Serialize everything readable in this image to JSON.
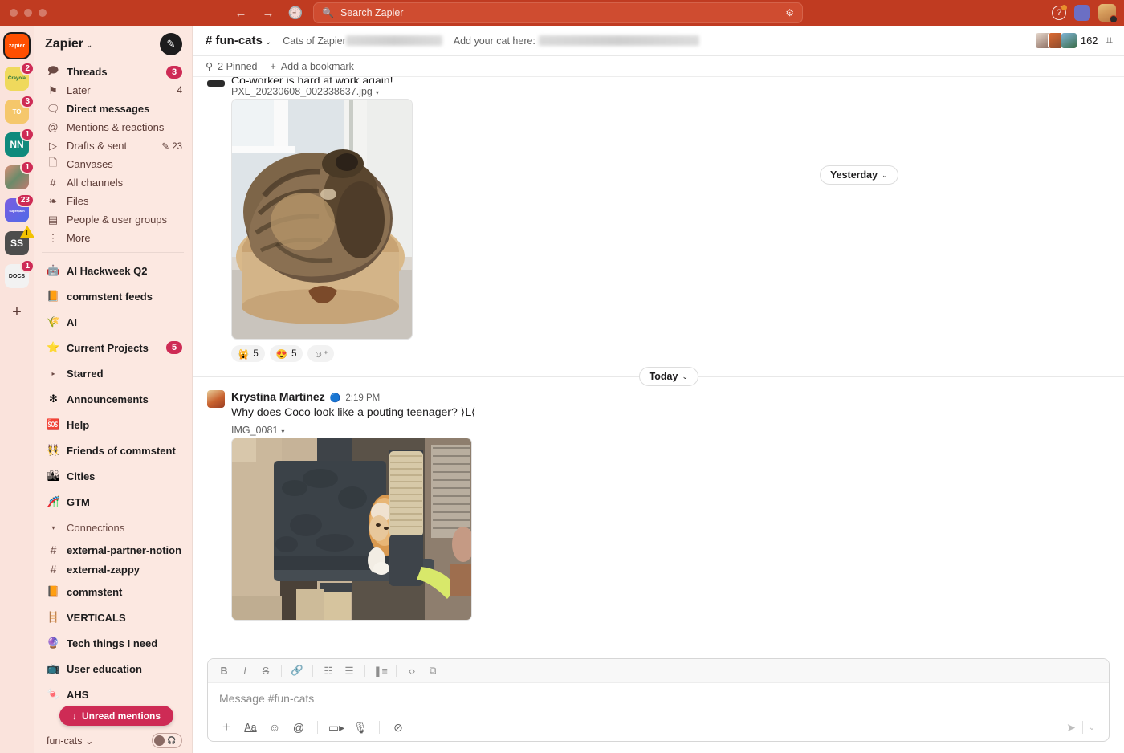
{
  "titlebar": {
    "back_icon": "back-arrow-icon",
    "forward_icon": "forward-arrow-icon",
    "history_icon": "history-clock-icon",
    "search_placeholder": "Search Zapier",
    "search_icon": "search-icon",
    "filter_icon": "search-filter-icon",
    "help_label": "?",
    "accent": "#C03B21"
  },
  "rail": {
    "workspaces": [
      {
        "name": "zapier",
        "label": "zapier",
        "badge": "",
        "active": true,
        "color": "#FF4F00"
      },
      {
        "name": "crayola",
        "label": "Crayola",
        "badge": "2",
        "active": false,
        "color": "#F3D84C"
      },
      {
        "name": "to",
        "label": "TO",
        "badge": "3",
        "active": false,
        "color": "#F5C26B"
      },
      {
        "name": "nn",
        "label": "NN",
        "badge": "1",
        "active": false,
        "color": "#0E8A7B"
      },
      {
        "name": "faces",
        "label": "",
        "badge": "1",
        "active": false,
        "color": "#C98B7A"
      },
      {
        "name": "superpath",
        "label": "superpath",
        "badge": "23",
        "active": false,
        "color": "#6C5CE7"
      },
      {
        "name": "ss",
        "label": "SS",
        "badge": "",
        "warning": true,
        "active": false,
        "color": "#4A4A4A"
      },
      {
        "name": "docs",
        "label": "DOCS",
        "badge": "1",
        "active": false,
        "color": "#E8E8E8"
      }
    ],
    "add_label": "+"
  },
  "sidebar": {
    "workspace_name": "Zapier",
    "chevron": "⌄",
    "compose_icon": "compose-pencil-icon",
    "nav": [
      {
        "icon": "💬",
        "icon_name": "threads-icon",
        "label": "Threads",
        "badge": "3",
        "count": "",
        "bold": true
      },
      {
        "icon": "🔖",
        "icon_name": "later-bookmark-icon",
        "label": "Later",
        "badge": "",
        "count": "4",
        "bold": false
      },
      {
        "icon": "🗨",
        "icon_name": "direct-messages-icon",
        "label": "Direct messages",
        "badge": "",
        "count": "",
        "bold": true
      },
      {
        "icon": "@",
        "icon_name": "mentions-at-icon",
        "label": "Mentions & reactions",
        "badge": "",
        "count": "",
        "bold": false
      },
      {
        "icon": "➤",
        "icon_name": "drafts-send-icon",
        "label": "Drafts & sent",
        "badge": "",
        "count": "✎ 23",
        "bold": false
      },
      {
        "icon": "🗒",
        "icon_name": "canvases-icon",
        "label": "Canvases",
        "badge": "",
        "count": "",
        "bold": false
      },
      {
        "icon": "#",
        "icon_name": "all-channels-icon",
        "label": "All channels",
        "badge": "",
        "count": "",
        "bold": false
      },
      {
        "icon": "≋",
        "icon_name": "files-stack-icon",
        "label": "Files",
        "badge": "",
        "count": "",
        "bold": false
      },
      {
        "icon": "▤",
        "icon_name": "people-groups-icon",
        "label": "People & user groups",
        "badge": "",
        "count": "",
        "bold": false
      },
      {
        "icon": "⋮",
        "icon_name": "more-kebab-icon",
        "label": "More",
        "badge": "",
        "count": "",
        "bold": false
      }
    ],
    "channels": [
      {
        "emoji": "🤖",
        "name": "AI Hackweek Q2",
        "badge": "",
        "unread": true,
        "kind": "emoji"
      },
      {
        "emoji": "📙",
        "name": "commstent feeds",
        "badge": "",
        "unread": true,
        "kind": "emoji"
      },
      {
        "emoji": "🌾",
        "name": "AI",
        "badge": "",
        "unread": true,
        "kind": "emoji"
      },
      {
        "emoji": "⭐",
        "name": "Current Projects",
        "badge": "5",
        "unread": true,
        "kind": "emoji"
      },
      {
        "emoji": "▸",
        "name": "Starred",
        "badge": "",
        "unread": true,
        "kind": "section"
      },
      {
        "emoji": "❇",
        "name": "Announcements",
        "badge": "",
        "unread": true,
        "kind": "emoji"
      },
      {
        "emoji": "🆘",
        "name": "Help",
        "badge": "",
        "unread": true,
        "kind": "emoji"
      },
      {
        "emoji": "👯",
        "name": "Friends of commstent",
        "badge": "",
        "unread": true,
        "kind": "emoji"
      },
      {
        "emoji": "🏙",
        "name": "Cities",
        "badge": "",
        "unread": true,
        "kind": "emoji"
      },
      {
        "emoji": "🎢",
        "name": "GTM",
        "badge": "",
        "unread": true,
        "kind": "emoji"
      },
      {
        "emoji": "▾",
        "name": "Connections",
        "badge": "",
        "unread": false,
        "kind": "section"
      },
      {
        "emoji": "#",
        "name": "external-partner-notion",
        "badge": "",
        "unread": true,
        "kind": "hash"
      },
      {
        "emoji": "#",
        "name": "external-zappy",
        "badge": "",
        "unread": true,
        "kind": "hash"
      },
      {
        "emoji": "📙",
        "name": "commstent",
        "badge": "",
        "unread": true,
        "kind": "emoji"
      },
      {
        "emoji": "🪜",
        "name": "VERTICALS",
        "badge": "",
        "unread": true,
        "kind": "emoji"
      },
      {
        "emoji": "🔮",
        "name": "Tech things I need",
        "badge": "",
        "unread": true,
        "kind": "emoji"
      },
      {
        "emoji": "📺",
        "name": "User education",
        "badge": "",
        "unread": true,
        "kind": "emoji"
      },
      {
        "emoji": "🍬",
        "name": "AHS",
        "badge": "",
        "unread": true,
        "kind": "emoji"
      }
    ],
    "unread_mentions_label": "Unread mentions",
    "unread_mentions_arrow": "↓",
    "footer_channel": "fun-cats",
    "footer_chevron": "⌄",
    "huddle_icon": "headphones-icon"
  },
  "channel": {
    "hash": "#",
    "name": "fun-cats",
    "chevron": "⌄",
    "topic_prefix": "Cats of Zapier",
    "topic_second": "Add your cat here:",
    "member_count": "162",
    "huddle_icon": "huddle-icon",
    "bookmarks": {
      "pin_icon": "pin-icon",
      "pinned_label": "2 Pinned",
      "add_icon": "+",
      "add_label": "Add a bookmark"
    }
  },
  "messages": {
    "clipped": {
      "text": "Co-worker is hard at work again!",
      "filename": "PXL_20230608_002338637.jpg",
      "caret": "▾",
      "reactions": [
        {
          "emoji": "🙀",
          "name": "reaction-scream-cat",
          "count": "5"
        },
        {
          "emoji": "😍",
          "name": "reaction-heart-eyes",
          "count": "5"
        }
      ],
      "add_reaction_icon": "add-reaction-icon"
    },
    "divider_yesterday": "Yesterday",
    "divider_today": "Today",
    "divider_chevron": "⌄",
    "krystina": {
      "author": "Krystina Martinez",
      "badge_icon": "🔵",
      "time": "2:19 PM",
      "text": "Why does Coco look like a pouting teenager? ⟩Ⅼ⟨",
      "filename": "IMG_0081",
      "caret": "▾"
    }
  },
  "composer": {
    "format_buttons": [
      {
        "name": "bold-button",
        "glyph": "B"
      },
      {
        "name": "italic-button",
        "glyph": "I"
      },
      {
        "name": "strikethrough-button",
        "glyph": "S"
      },
      {
        "name": "link-button",
        "glyph": "🔗"
      },
      {
        "name": "ordered-list-button",
        "glyph": "⒈"
      },
      {
        "name": "bulleted-list-button",
        "glyph": "☰"
      },
      {
        "name": "blockquote-button",
        "glyph": "❝"
      },
      {
        "name": "code-button",
        "glyph": "‹›"
      },
      {
        "name": "code-block-button",
        "glyph": "⧉"
      }
    ],
    "placeholder": "Message #fun-cats",
    "action_buttons": [
      {
        "name": "attach-plus-button",
        "glyph": "+"
      },
      {
        "name": "formatting-aa-button",
        "glyph": "Aa"
      },
      {
        "name": "emoji-button",
        "glyph": "☺"
      },
      {
        "name": "mention-button",
        "glyph": "@"
      },
      {
        "name": "video-clip-button",
        "glyph": "▭"
      },
      {
        "name": "audio-clip-button",
        "glyph": "🎤"
      },
      {
        "name": "slash-command-button",
        "glyph": "⊘"
      }
    ],
    "send_icon": "send-plane-icon",
    "send_caret": "⌄"
  }
}
